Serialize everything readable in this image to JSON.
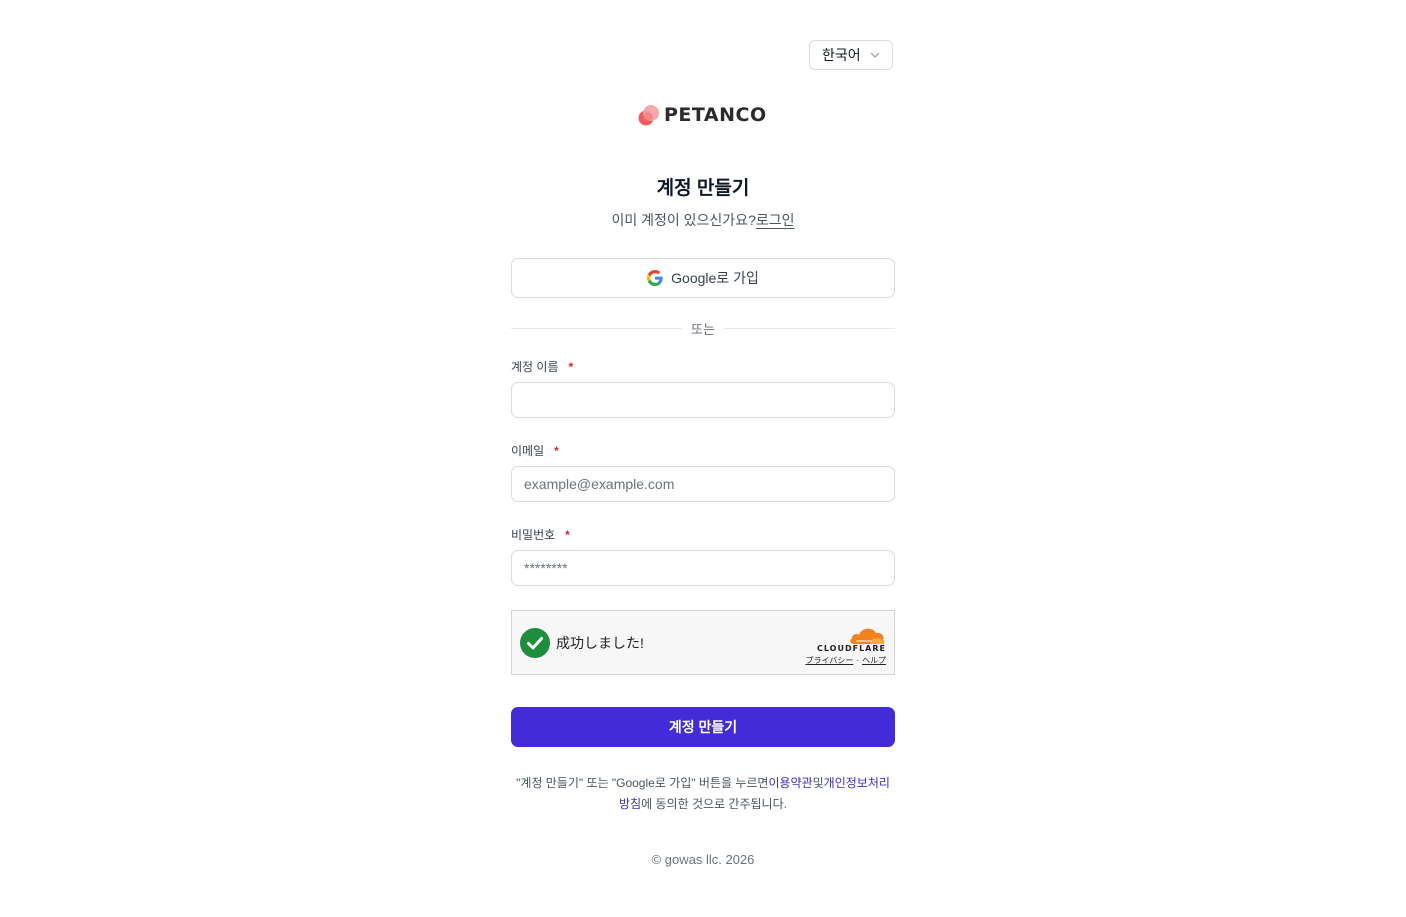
{
  "language": {
    "selected": "한국어",
    "icon": "chevron-down-icon"
  },
  "brand": {
    "name": "PETANCO",
    "accent": "#f26b6b"
  },
  "header": {
    "title": "계정 만들기",
    "subtitle_prefix": "이미 계정이 있으신가요?",
    "login_link": "로그인"
  },
  "oauth": {
    "google_label": "Google로 가입",
    "icon": "google-icon"
  },
  "divider": {
    "label": "또는"
  },
  "form": {
    "username": {
      "label": "계정 이름",
      "required_mark": "*",
      "value": "",
      "placeholder": ""
    },
    "email": {
      "label": "이메일",
      "required_mark": "*",
      "value": "",
      "placeholder": "example@example.com"
    },
    "password": {
      "label": "비밀번호",
      "required_mark": "*",
      "value": "",
      "placeholder": "********"
    }
  },
  "captcha": {
    "status": "成功しました!",
    "provider": "CLOUDFLARE",
    "privacy_link": "プライバシー",
    "separator": "·",
    "help_link": "ヘルプ",
    "success_color": "#1e8e3e",
    "cloud_color": "#f48120"
  },
  "submit": {
    "label": "계정 만들기",
    "color": "#432bd9"
  },
  "terms": {
    "prefix": "\"계정 만들기\" 또는 \"Google로 가입\" 버튼을 누르면",
    "terms_link": "이용약관",
    "conjunction": "및",
    "privacy_link": "개인정보처리방침",
    "suffix": "에 동의한 것으로 간주됩니다."
  },
  "footer": {
    "copyright": "©  gowas llc. 2026"
  }
}
